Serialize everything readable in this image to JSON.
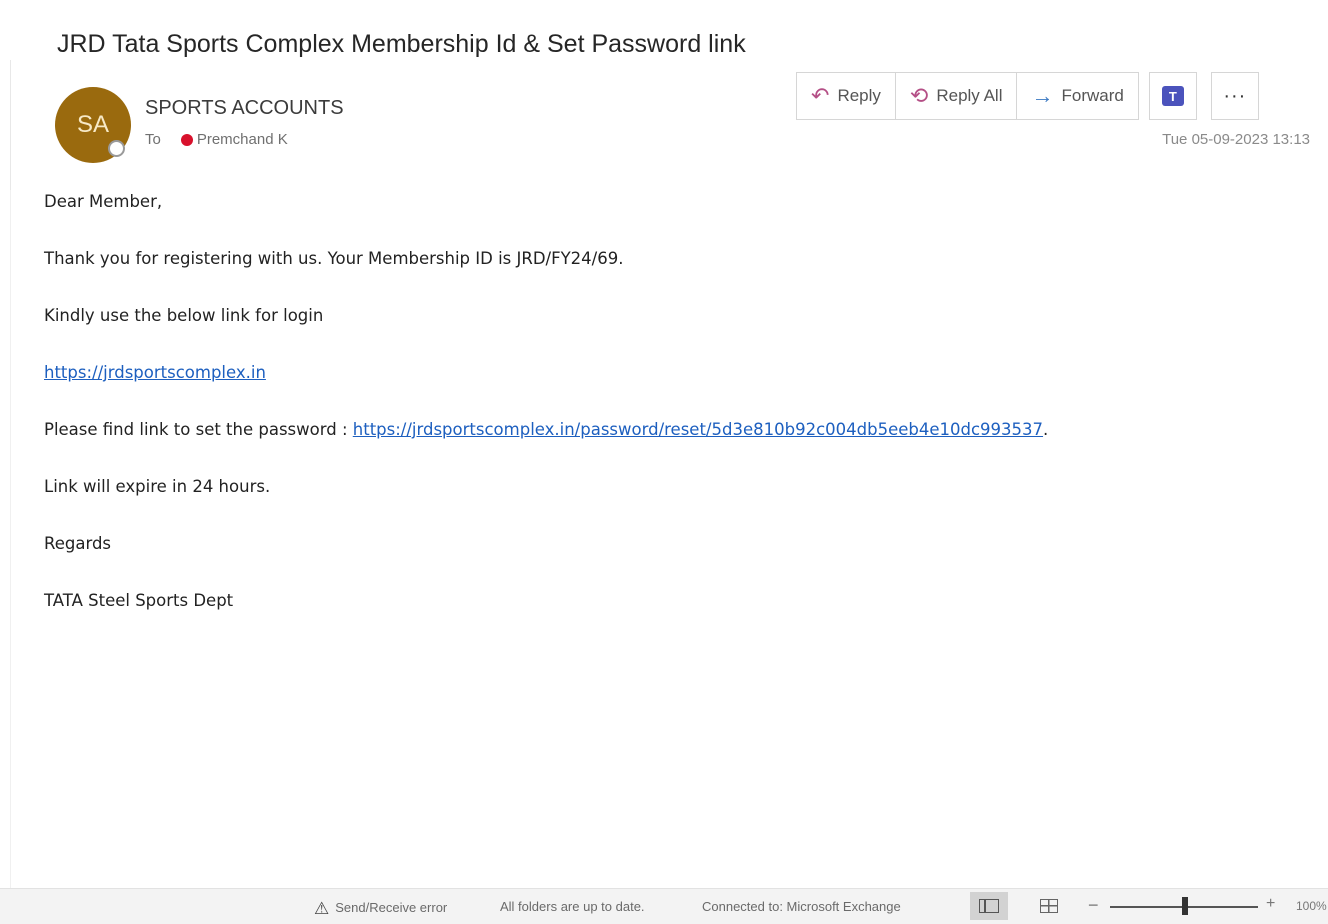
{
  "email": {
    "subject": "JRD Tata Sports Complex Membership Id & Set Password link",
    "avatar_initials": "SA",
    "avatar_color": "#9a6a0e",
    "sender": "SPORTS ACCOUNTS",
    "to_label": "To",
    "recipient": "Premchand K",
    "datetime": "Tue 05-09-2023 13:13"
  },
  "toolbar": {
    "reply": "Reply",
    "reply_all": "Reply All",
    "forward": "Forward",
    "teams_icon": "teams-icon",
    "more": "···"
  },
  "body": {
    "greeting": "Dear Member,",
    "line1": "Thank you for registering with us. Your Membership ID is JRD/FY24/69.",
    "line2": "Kindly use the below link for login",
    "login_link": "https://jrdsportscomplex.in",
    "password_prefix": "Please find link to set the password : ",
    "password_link": "https://jrdsportscomplex.in/password/reset/5d3e810b92c004db5eeb4e10dc993537",
    "password_suffix": ".",
    "expiry": "Link will expire in 24 hours.",
    "regards": "Regards",
    "signature": "TATA Steel Sports Dept"
  },
  "statusbar": {
    "error": "Send/Receive error",
    "folders": "All folders are up to date.",
    "connection": "Connected to: Microsoft Exchange",
    "zoom_minus": "−",
    "zoom_plus": "+",
    "zoom_value": "100%"
  },
  "colors": {
    "link": "#1d5fbf",
    "presence_red": "#d8112c",
    "reply_icon": "#b44f86",
    "forward_icon": "#3a78c2"
  }
}
